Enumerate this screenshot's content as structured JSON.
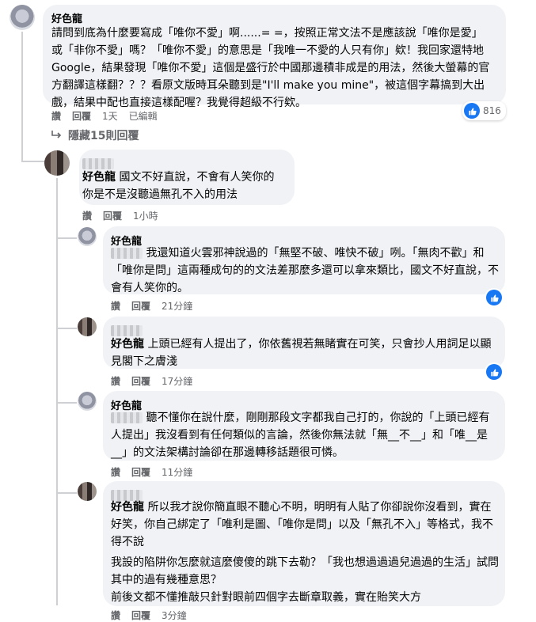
{
  "comments": [
    {
      "author": "好色龍",
      "text": "請問到底為什麼要寫成「唯你不愛」啊......= =，按照正常文法不是應該說「唯你是愛」或「非你不愛」嗎？「唯你不愛」的意思是「我唯一不愛的人只有你」欸！我回家還特地Google，結果發現「唯你不愛」這個是盛行於中國那邊積非成是的用法，然後大螢幕的官方翻譯這樣翻？？？看原文版時耳朵聽到是\"I'll make you mine\"，被這個字幕搞到大出戲，結果中配也直接這樣配喔？我覺得超級不行欸。",
      "meta": [
        "讚",
        "回覆",
        "1天",
        "已編輯"
      ],
      "likes": "816"
    }
  ],
  "hidden_replies_label": "隱藏15則回覆",
  "replies": [
    {
      "mention": "好色龍",
      "text": "國文不好直說，不會有人笑你的\n你是不是沒聽過無孔不入的用法",
      "meta": [
        "讚",
        "回覆",
        "1小時"
      ]
    },
    {
      "author": "好色龍",
      "text": "我還知道火雲邪神說過的「無堅不破、唯快不破」咧。「無肉不歡」和「唯你是問」這兩種成句的的文法差那麼多還可以拿來類比，國文不好直說，不會有人笑你的。",
      "meta": [
        "讚",
        "回覆",
        "21分鐘"
      ]
    },
    {
      "mention": "好色龍",
      "text": "上頭已經有人提出了，你依舊視若無睹實在可笑，只會抄人用詞足以顯見閣下之膚淺",
      "meta": [
        "讚",
        "回覆",
        "17分鐘"
      ]
    },
    {
      "author": "好色龍",
      "text": "聽不懂你在說什麼，剛剛那段文字都我自己打的，你說的「上頭已經有人提出」我沒看到有任何類似的言論，然後你無法就「無__不__」和「唯__是__」的文法架構討論卻在那邊轉移話題很可憐。",
      "meta": [
        "讚",
        "回覆",
        "11分鐘"
      ]
    },
    {
      "mention": "好色龍",
      "text": "所以我才說你簡直眼不聽心不明，明明有人貼了你卻說你沒看到，實在好笑，你自己綁定了「唯利是圖、「唯你是問」以及「無孔不入」等格式，我不得不說",
      "text2": "我設的陷阱你怎麼就這麼傻傻的跳下去勒？「我也想過過過兒過過的生活」試問其中的過有幾種意思？\n前後文都不懂推敲只針對眼前四個字去斷章取義，實在貽笑大方",
      "meta": [
        "讚",
        "回覆",
        "3分鐘"
      ]
    }
  ],
  "colors": {
    "accent": "#1877f2",
    "bubble": "#f0f2f5",
    "muted": "#65676b"
  }
}
